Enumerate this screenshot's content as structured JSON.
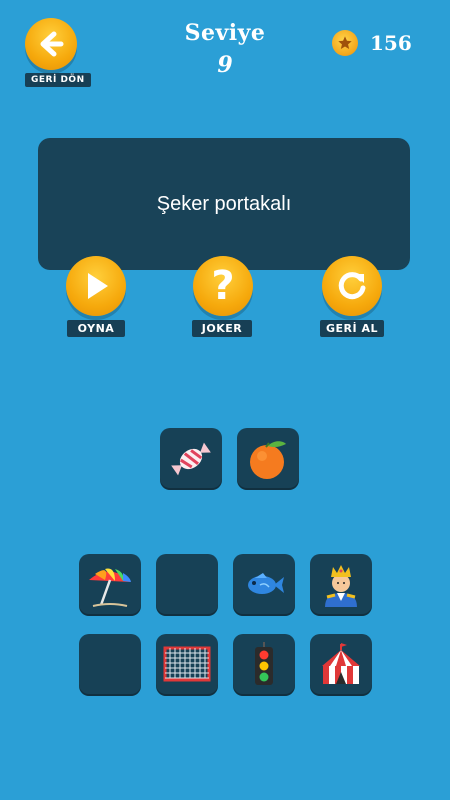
{
  "header": {
    "back_label": "GERİ DÖN",
    "level_title": "Seviye",
    "level_number": "9",
    "coins": "156",
    "back_icon": "arrow-left-icon",
    "coin_icon": "coin-star-icon"
  },
  "question": {
    "text": "Şeker portakalı"
  },
  "actions": {
    "play_label": "OYNA",
    "joker_label": "JOKER",
    "undo_label": "GERİ AL"
  },
  "answer_slots": [
    {
      "emoji": "candy"
    },
    {
      "emoji": "orange"
    }
  ],
  "emoji_pool": [
    {
      "emoji": "beach-umbrella"
    },
    {
      "emoji": "empty"
    },
    {
      "emoji": "fish"
    },
    {
      "emoji": "prince"
    },
    {
      "emoji": "empty"
    },
    {
      "emoji": "goal-net"
    },
    {
      "emoji": "traffic-light"
    },
    {
      "emoji": "circus-tent"
    }
  ],
  "colors": {
    "background": "#2b9fd6",
    "card": "#194358",
    "tile": "#174156",
    "button": "#f6a90c"
  }
}
